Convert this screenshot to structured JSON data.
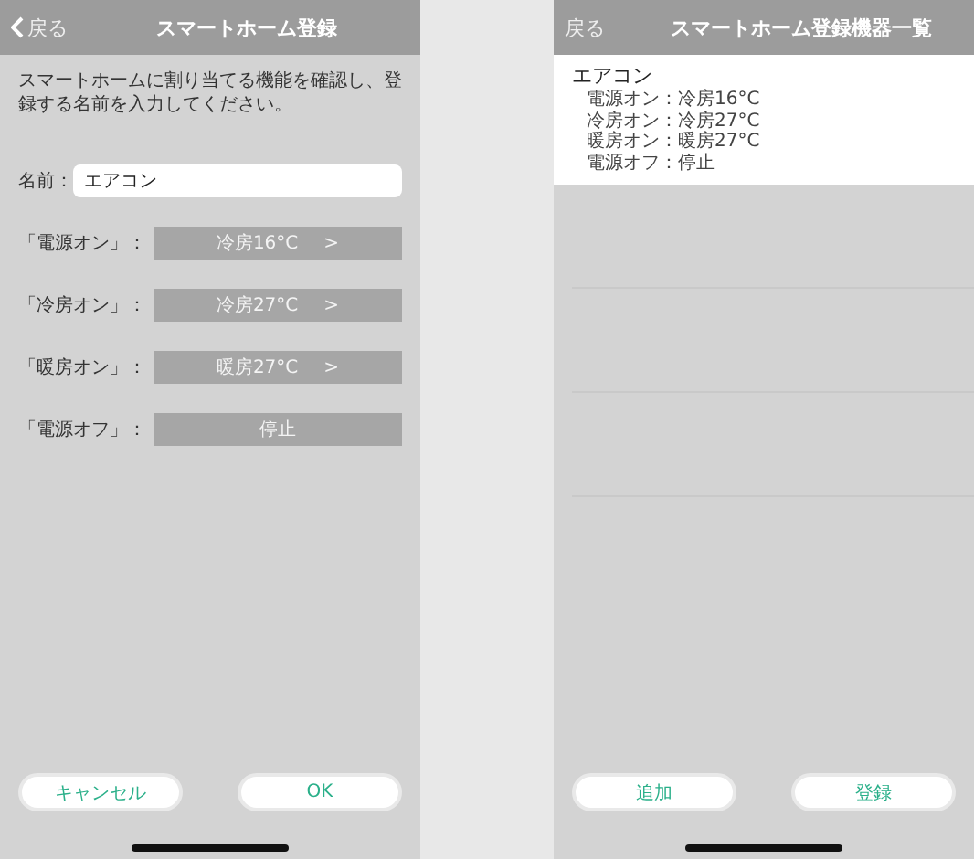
{
  "register_screen": {
    "back": "戻る",
    "title": "スマートホーム登録",
    "description": "スマートホームに割り当てる機能を確認し、登録する名前を入力してください。",
    "name_field": {
      "label": "名前：",
      "value": "エアコン"
    },
    "assignments": [
      {
        "label": "「電源オン」：",
        "value": "冷房16°C",
        "arrow": ">"
      },
      {
        "label": "「冷房オン」：",
        "value": "冷房27°C",
        "arrow": ">"
      },
      {
        "label": "「暖房オン」：",
        "value": "暖房27°C",
        "arrow": ">"
      },
      {
        "label": "「電源オフ」：",
        "value": "停止"
      }
    ],
    "buttons": [
      "キャンセル",
      "OK"
    ]
  },
  "list_screen": {
    "back": "戻る",
    "title": "スマートホーム登録機器一覧",
    "devices": [
      {
        "name": "エアコン",
        "details": [
          "電源オン：冷房16°C",
          "冷房オン：冷房27°C",
          "暖房オン：暖房27°C",
          "電源オフ：停止"
        ]
      }
    ],
    "buttons": [
      "追加",
      "登録"
    ]
  }
}
